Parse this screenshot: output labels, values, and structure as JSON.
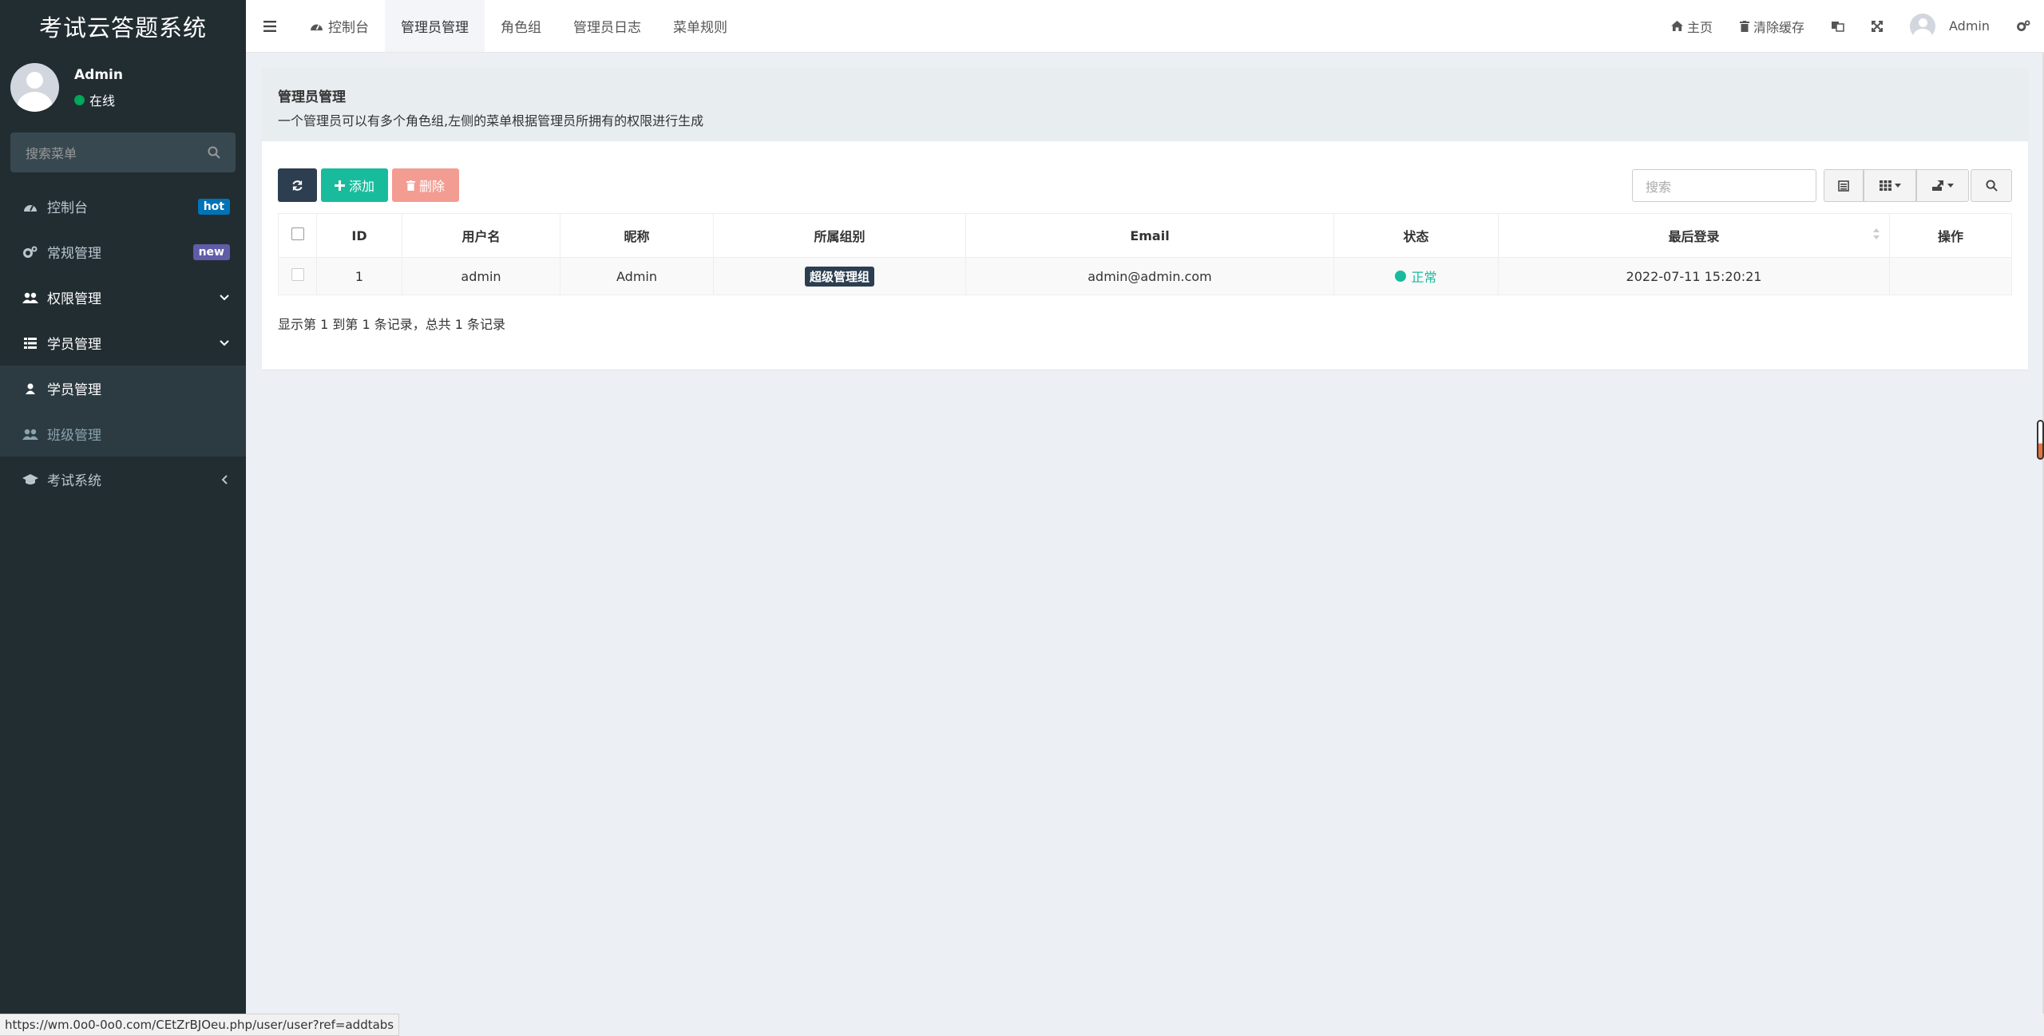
{
  "app": {
    "title": "考试云答题系统"
  },
  "sidebar": {
    "user": {
      "name": "Admin",
      "status": "在线"
    },
    "search_placeholder": "搜索菜单",
    "items": [
      {
        "label": "控制台",
        "icon": "dashboard-icon",
        "badge": "hot"
      },
      {
        "label": "常规管理",
        "icon": "cogs-icon",
        "badge": "new"
      },
      {
        "label": "权限管理",
        "icon": "group-icon"
      },
      {
        "label": "学员管理",
        "icon": "list-icon"
      },
      {
        "label": "学员管理",
        "icon": "user-icon"
      },
      {
        "label": "班级管理",
        "icon": "users-icon"
      },
      {
        "label": "考试系统",
        "icon": "graduation-cap-icon"
      }
    ]
  },
  "topnav": {
    "tabs": [
      {
        "label": "控制台",
        "icon": "dashboard-icon"
      },
      {
        "label": "管理员管理"
      },
      {
        "label": "角色组"
      },
      {
        "label": "管理员日志"
      },
      {
        "label": "菜单规则"
      }
    ],
    "right": {
      "home": "主页",
      "clear_cache": "清除缓存",
      "user": "Admin"
    }
  },
  "panel": {
    "title": "管理员管理",
    "description": "一个管理员可以有多个角色组,左侧的菜单根据管理员所拥有的权限进行生成",
    "buttons": {
      "add": "添加",
      "delete": "删除"
    },
    "search_placeholder": "搜索"
  },
  "table": {
    "headers": [
      "ID",
      "用户名",
      "昵称",
      "所属组别",
      "Email",
      "状态",
      "最后登录",
      "操作"
    ],
    "rows": [
      {
        "id": "1",
        "username": "admin",
        "nickname": "Admin",
        "group": "超级管理组",
        "email": "admin@admin.com",
        "status": "正常",
        "last_login": "2022-07-11 15:20:21",
        "actions": ""
      }
    ]
  },
  "pager_text": "显示第 1 到第 1 条记录，总共 1 条记录",
  "status_url": "https://wm.0o0-0o0.com/CEtZrBJOeu.php/user/user?ref=addtabs",
  "colors": {
    "sidebar": "#222d32",
    "accent_green": "#18bc9c",
    "danger": "#f39c92",
    "dark_btn": "#2c3e50",
    "hot": "#0073b7",
    "new": "#605ca8"
  }
}
